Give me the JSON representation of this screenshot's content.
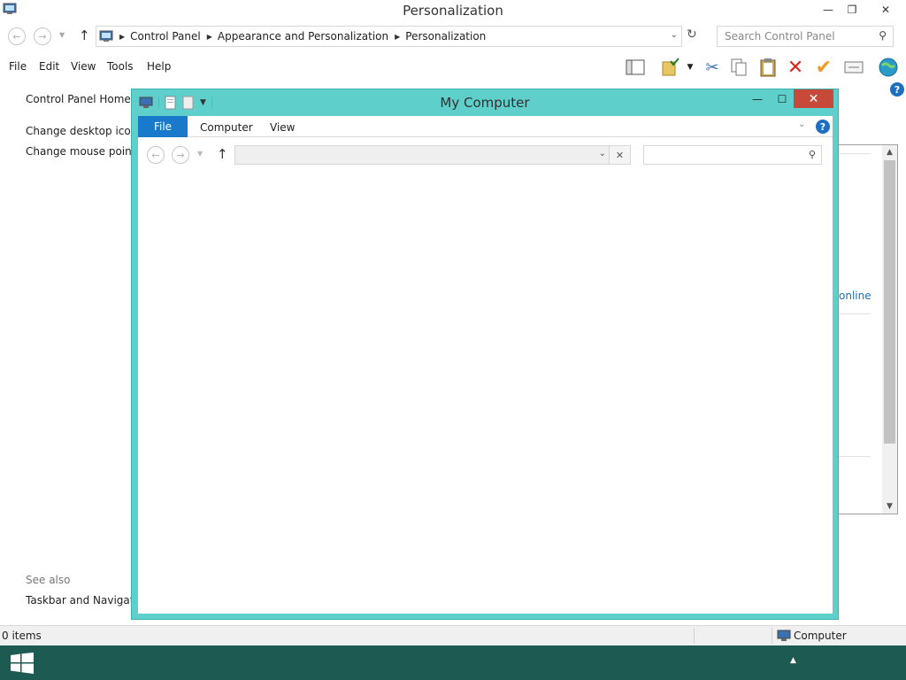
{
  "window": {
    "title": "Personalization",
    "controls": {
      "minimize": "—",
      "restore": "❐",
      "close": "✕"
    }
  },
  "address": {
    "crumbs": [
      "Control Panel",
      "Appearance and Personalization",
      "Personalization"
    ],
    "search_placeholder": "Search Control Panel"
  },
  "menu": [
    "File",
    "Edit",
    "View",
    "Tools",
    "Help"
  ],
  "left_pane": {
    "home": "Control Panel Home",
    "links": [
      "Change desktop icons",
      "Change mouse pointers"
    ],
    "see_also_heading": "See also",
    "see_also_links": [
      "Taskbar and Navigation"
    ]
  },
  "right_panel": {
    "partial_link": "online"
  },
  "status": {
    "items": "0 items",
    "zone": "Computer"
  },
  "my_computer": {
    "title": "My Computer",
    "tabs": {
      "file": "File",
      "computer": "Computer",
      "view": "View"
    },
    "address_value": "",
    "search_value": ""
  },
  "colors": {
    "dialog_frame": "#5ecfcb",
    "close_button": "#c7493a",
    "file_tab": "#1979ca",
    "taskbar": "#1d5a52",
    "link": "#1c6fc1"
  }
}
